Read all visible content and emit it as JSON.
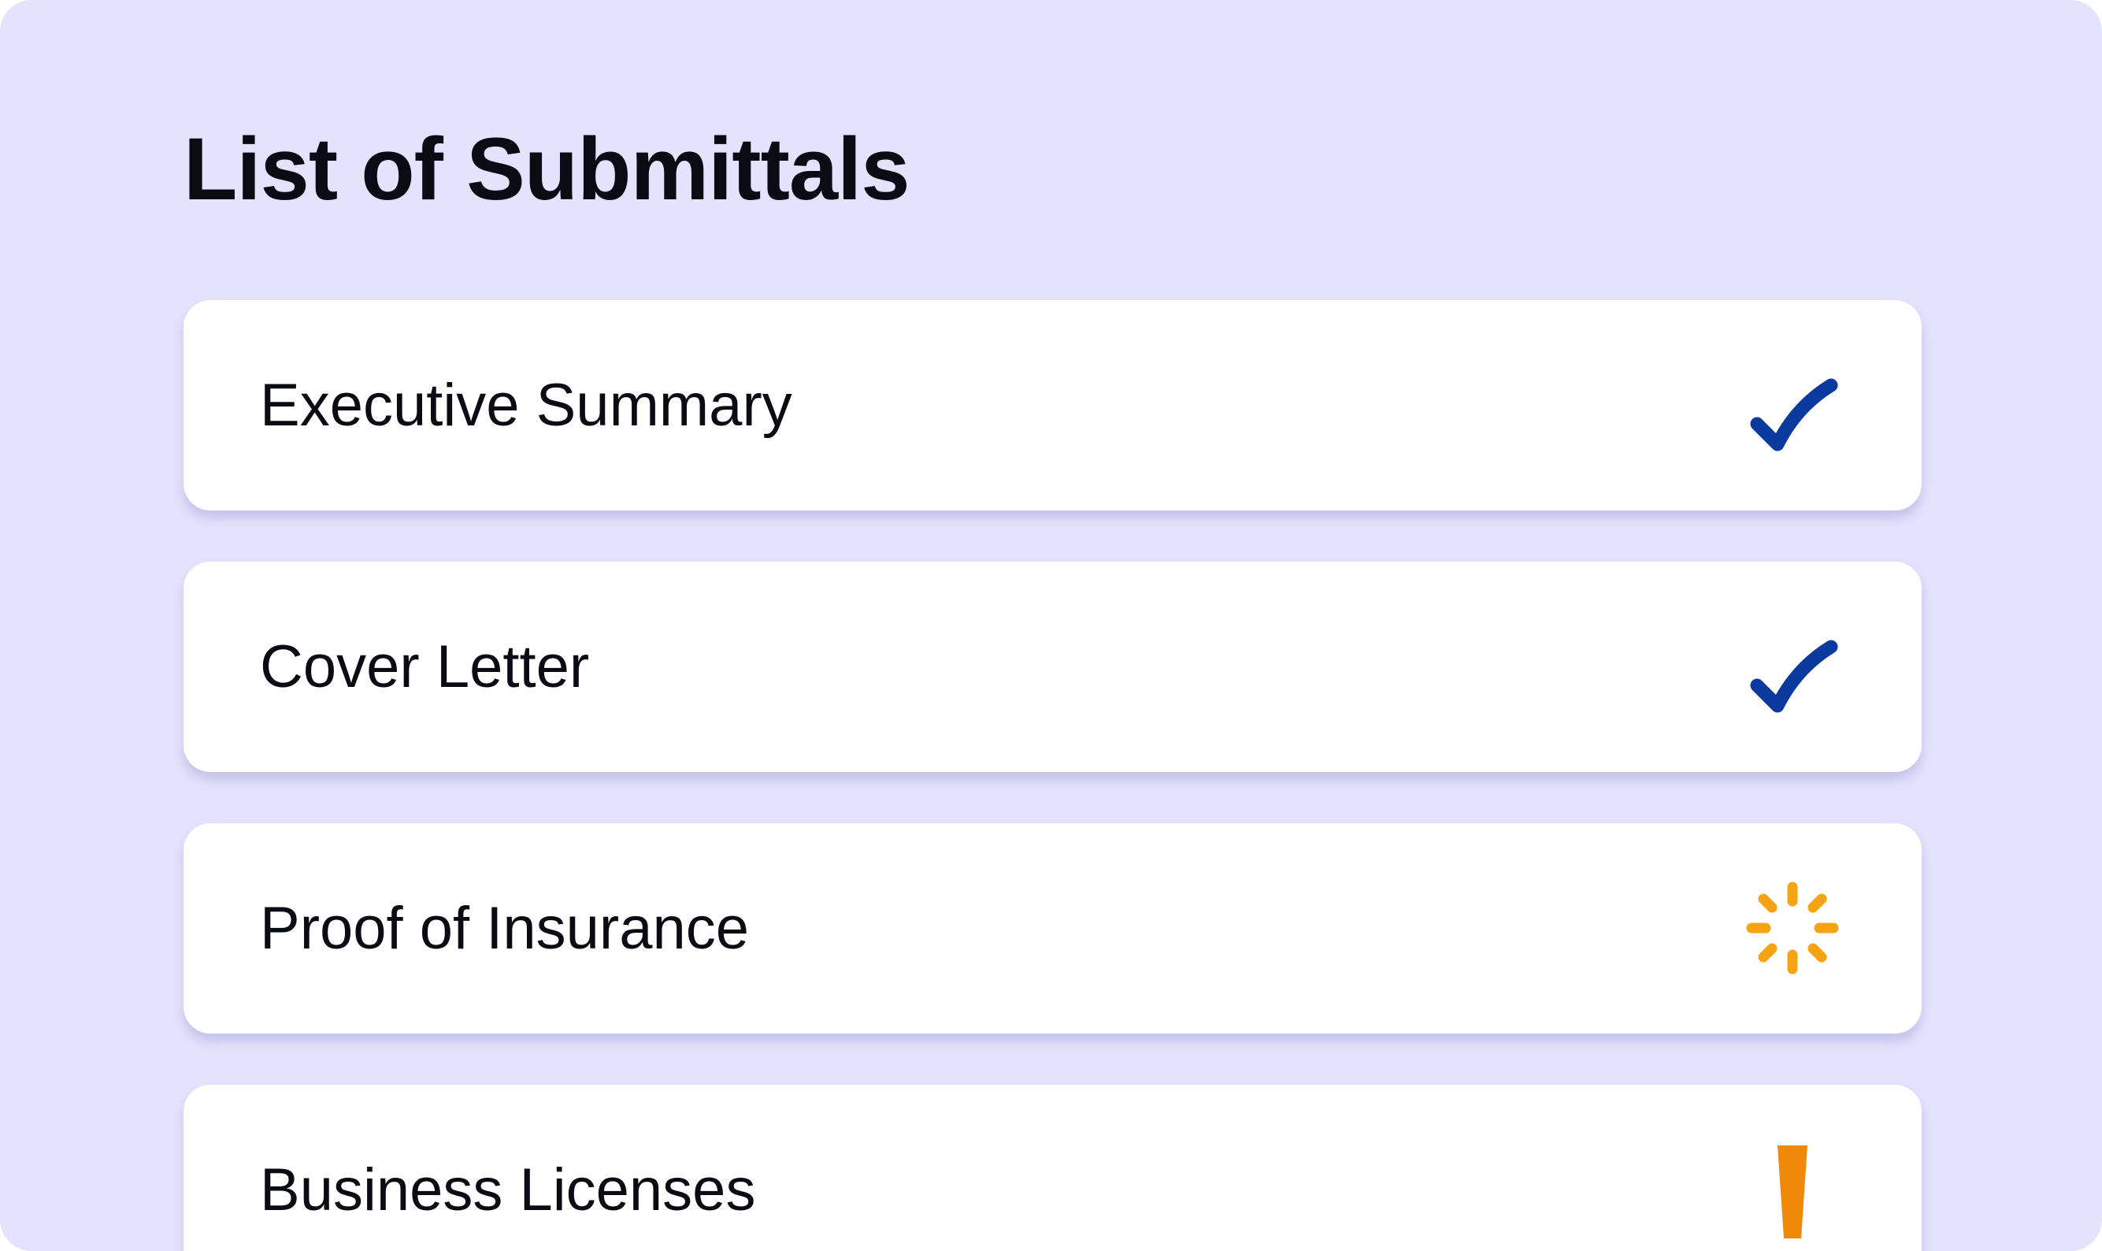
{
  "page": {
    "title": "List of Submittals"
  },
  "submittals": [
    {
      "label": "Executive Summary",
      "status": "complete",
      "icon": "check-icon",
      "color": "#0a3a9e"
    },
    {
      "label": "Cover Letter",
      "status": "complete",
      "icon": "check-icon",
      "color": "#0a3a9e"
    },
    {
      "label": "Proof of Insurance",
      "status": "in-progress",
      "icon": "spinner-icon",
      "color": "#f6a313"
    },
    {
      "label": "Business Licenses",
      "status": "attention",
      "icon": "exclamation-icon",
      "color": "#f0890a"
    }
  ],
  "colors": {
    "background": "#e5e2fe",
    "card": "#ffffff",
    "text": "#0b0b14"
  }
}
